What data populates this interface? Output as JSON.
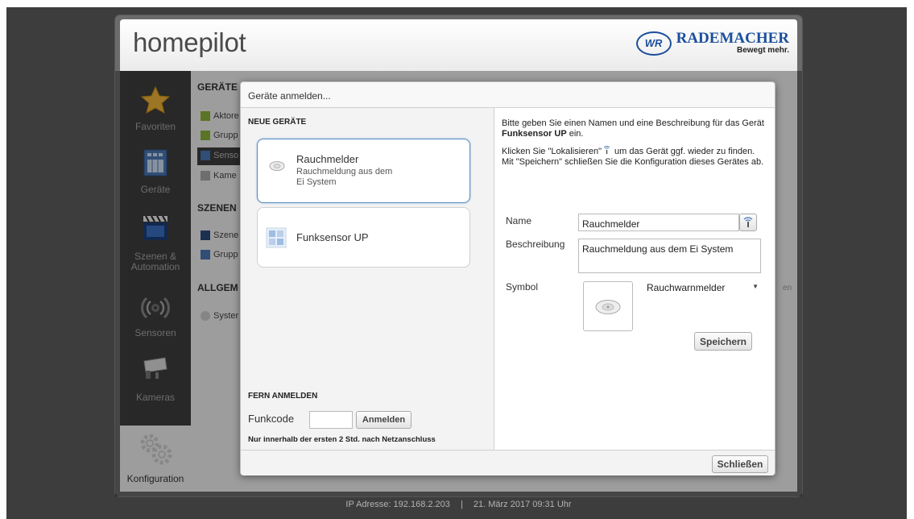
{
  "app": {
    "brand": "homepilot",
    "logo_mark": "WR",
    "logo_name": "RADEMACHER",
    "logo_slogan": "Bewegt mehr."
  },
  "sidebar": {
    "items": [
      {
        "label": "Favoriten",
        "icon": "star-icon"
      },
      {
        "label": "Geräte",
        "icon": "devices-icon"
      },
      {
        "label": "Szenen & Automation",
        "icon": "clapperboard-icon"
      },
      {
        "label": "Sensoren",
        "icon": "sensor-icon"
      },
      {
        "label": "Kameras",
        "icon": "camera-icon"
      }
    ],
    "config_label": "Konfiguration"
  },
  "background": {
    "geraete_head": "GERÄTE",
    "geraete_items": [
      "Aktore",
      "Grupp",
      "Senso",
      "Kame"
    ],
    "szenen_head": "SZENEN",
    "szenen_items": [
      "Szene",
      "Grupp"
    ],
    "allgem_head": "ALLGEM",
    "allgem_items": [
      "Syster"
    ],
    "right_edge": "en"
  },
  "modal": {
    "title": "Geräte anmelden...",
    "new_devices_head": "NEUE GERÄTE",
    "devices": [
      {
        "title": "Rauchmelder",
        "subtitle_line1": "Rauchmeldung aus dem",
        "subtitle_line2": "Ei System"
      },
      {
        "title": "Funksensor UP"
      }
    ],
    "fern_head": "FERN ANMELDEN",
    "funkcode_label": "Funkcode",
    "funkcode_value": "",
    "anmelden_button": "Anmelden",
    "fern_note": "Nur innerhalb der ersten 2 Std. nach Netzanschluss",
    "instruction_1a": "Bitte geben Sie einen Namen und eine Beschreibung für das Gerät ",
    "instruction_1b": "Funksensor UP",
    "instruction_1c": " ein.",
    "instruction_2a": "Klicken Sie \"Lokalisieren\"",
    "instruction_2b": " um das Gerät ggf. wieder zu finden. Mit \"Speichern\" schließen Sie die Konfiguration dieses Gerätes ab.",
    "name_label": "Name",
    "name_value": "Rauchmelder",
    "description_label": "Beschreibung",
    "description_value": "Rauchmeldung aus dem Ei System",
    "symbol_label": "Symbol",
    "symbol_selected": "Rauchwarnmelder",
    "save_button": "Speichern",
    "close_button": "Schließen"
  },
  "status": {
    "ip_label": "IP Adresse:",
    "ip_value": "192.168.2.203",
    "separator": "|",
    "datetime": "21. März 2017 09:31 Uhr"
  },
  "colors": {
    "accent": "#5b8fc4",
    "logo_blue": "#1b4f9c",
    "sidebar": "#3e3e3e"
  }
}
